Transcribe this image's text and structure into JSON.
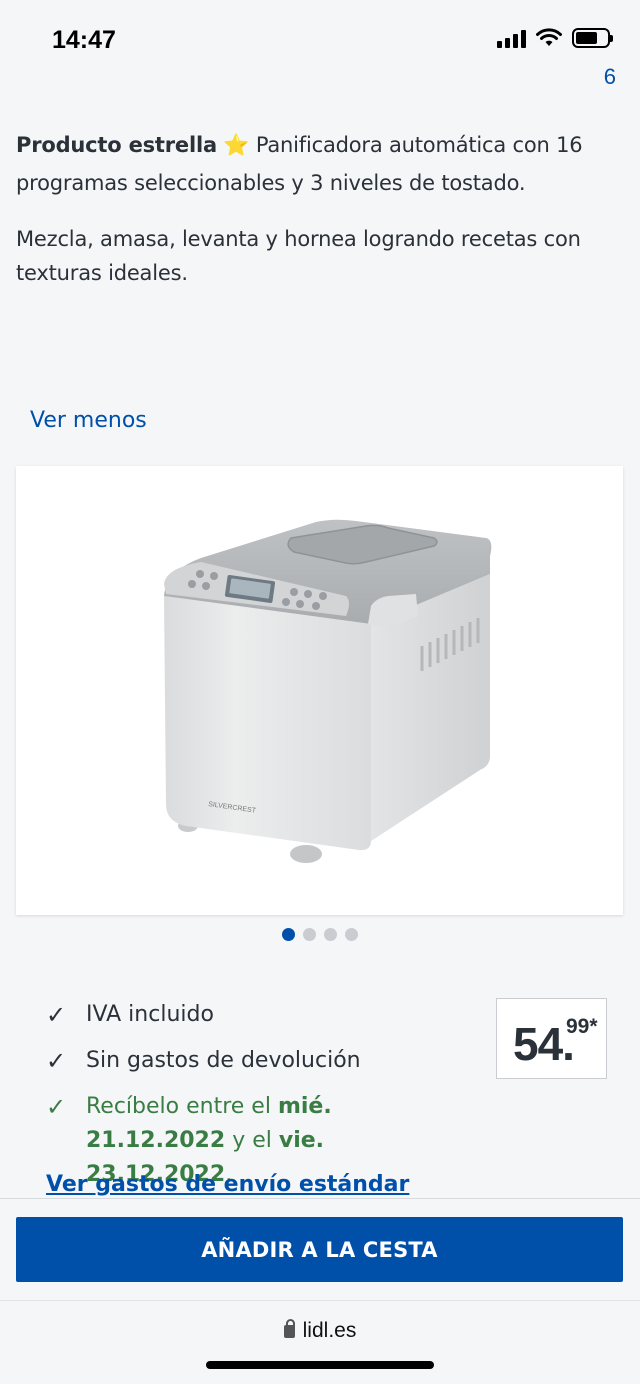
{
  "status_bar": {
    "time": "14:47"
  },
  "corner_glyph": "6",
  "description": {
    "highlight": "Producto estrella",
    "star": "⭐",
    "line1_rest": "Panificadora automática con 16 programas seleccionables y 3 niveles de tostado.",
    "para2": "Mezcla, amasa, levanta y hornea logrando recetas con texturas ideales."
  },
  "ver_menos": "Ver menos",
  "product_image": {
    "brand_text": "SILVERCREST"
  },
  "carousel": {
    "count": 4,
    "active_index": 0
  },
  "features": [
    {
      "text": "IVA incluido"
    },
    {
      "text": "Sin gastos de devolución"
    }
  ],
  "delivery": {
    "prefix": "Recíbelo entre el",
    "date1": "mié. 21.12.2022",
    "middle": "y el",
    "date2": "vie. 23.12.2022",
    "suffix": "."
  },
  "price": {
    "integer": "54.",
    "decimal": "99*"
  },
  "shipping_link": "Ver gastos de envío estándar",
  "add_to_cart": "AÑADIR A LA CESTA",
  "browser": {
    "url": "lidl.es"
  },
  "colors": {
    "accent": "#0050aa",
    "success": "#3a7d44"
  }
}
